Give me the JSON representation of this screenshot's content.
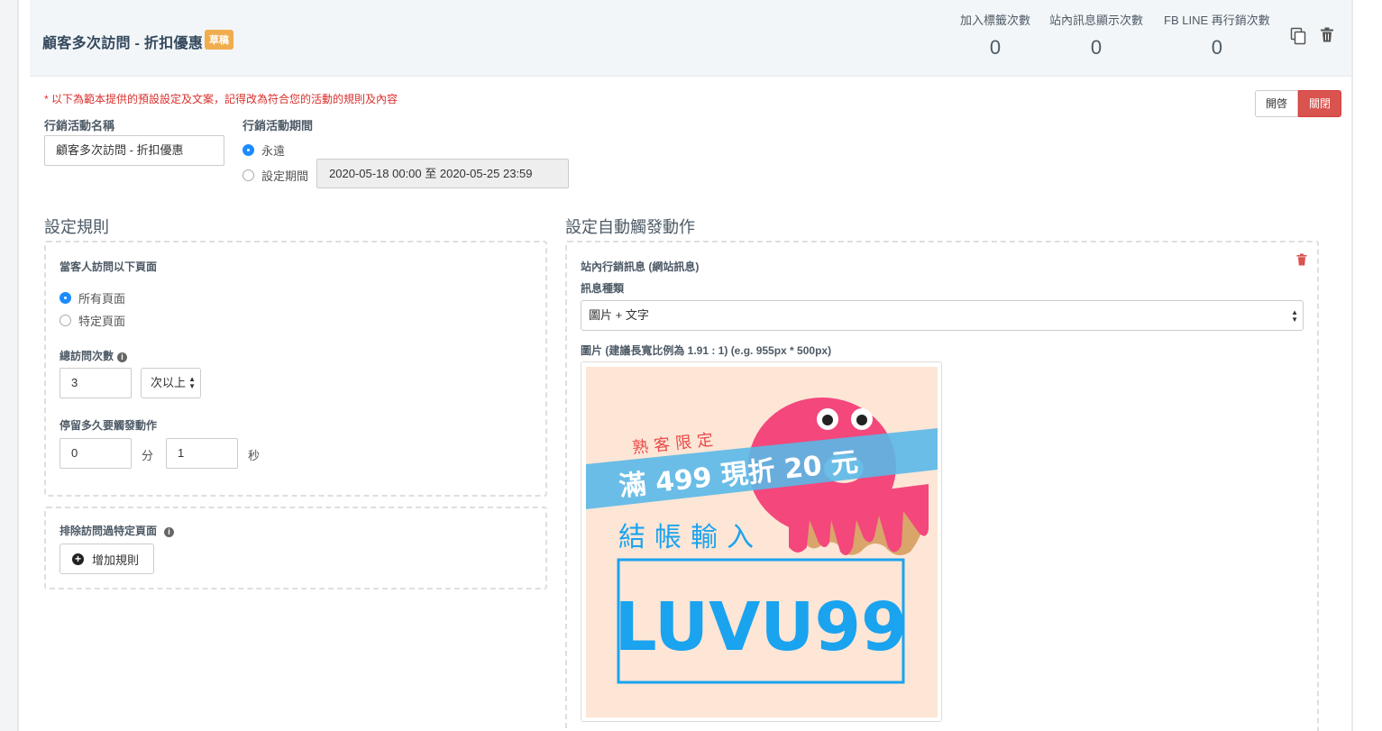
{
  "header": {
    "title": "顧客多次訪問 - 折扣優惠",
    "badge": "草稿",
    "stats": [
      {
        "label": "加入標籤次數",
        "value": "0"
      },
      {
        "label": "站內訊息顯示次數",
        "value": "0"
      },
      {
        "label": "FB LINE 再行銷次數",
        "value": "0"
      }
    ],
    "icons": {
      "copy": "copy-icon",
      "delete": "trash-icon"
    }
  },
  "notice": "* 以下為範本提供的預設設定及文案，記得改為符合您的活動的規則及內容",
  "toggle": {
    "on_label": "開啓",
    "off_label": "關閉",
    "active": "off",
    "off_color": "#d9534f"
  },
  "campaign": {
    "name_label": "行銷活動名稱",
    "name_value": "顧客多次訪問 - 折扣優惠",
    "period_label": "行銷活動期間",
    "period_options": [
      {
        "label": "永遠",
        "checked": true
      },
      {
        "label": "設定期間",
        "checked": false
      }
    ],
    "period_range": "2020-05-18 00:00 至 2020-05-25 23:59"
  },
  "rules": {
    "title": "設定規則",
    "visit_label": "當客人訪問以下頁面",
    "page_options": [
      {
        "label": "所有頁面",
        "checked": true
      },
      {
        "label": "特定頁面",
        "checked": false
      }
    ],
    "total_visits_label": "總訪問次數",
    "total_visits_value": "3",
    "visits_qualifier": "次以上",
    "stay_label": "停留多久要觸發動作",
    "stay_minutes": "0",
    "minutes_unit": "分",
    "stay_seconds": "1",
    "seconds_unit": "秒",
    "exclude_label": "排除訪問過特定頁面",
    "add_rule_button": "增加規則"
  },
  "actions": {
    "title": "設定自動觸發動作",
    "message_title": "站內行銷訊息 (網站訊息)",
    "message_type_label": "訊息種類",
    "message_type_value": "圖片 + 文字",
    "image_label": "圖片 (建議長寬比例為 1.91 : 1) (e.g. 955px * 500px)",
    "banner": {
      "tagline": "熟客限定",
      "offer": "滿 499 現折 20 元",
      "checkout": "結帳輸入",
      "code": "LUVU99",
      "colors": {
        "background": "#fde6d6",
        "ribbon": "#5ab8e8",
        "donut": "#f4477c",
        "code": "#1aa3ef",
        "tagline": "#e94b4b"
      }
    }
  },
  "colors": {
    "accent": "#1a8cff",
    "danger": "#d9534f",
    "badge": "#f0ad4e",
    "warning_text": "#d9302c"
  }
}
